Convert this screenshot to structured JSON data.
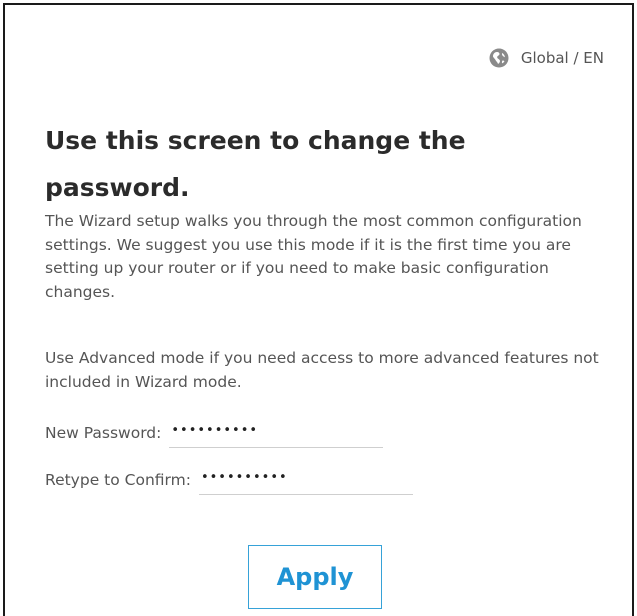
{
  "header": {
    "language_label": "Global / EN",
    "globe_icon": "globe-icon"
  },
  "main": {
    "title": "Use this screen to change the password.",
    "paragraph1": "The Wizard setup walks you through the most common configuration settings. We suggest you use this mode if it is the first time you are setting up your router or if you need to make basic configuration changes.",
    "paragraph2": "Use Advanced mode if you need access to more advanced features not included in Wizard mode.",
    "new_password": {
      "label": "New Password:",
      "value": "••••••••••"
    },
    "confirm_password": {
      "label": "Retype to Confirm:",
      "value": "••••••••••"
    },
    "apply_label": "Apply"
  },
  "colors": {
    "accent": "#1f93d4",
    "button_border": "#36a2d8",
    "text": "#555555",
    "heading": "#2b2b2b"
  }
}
